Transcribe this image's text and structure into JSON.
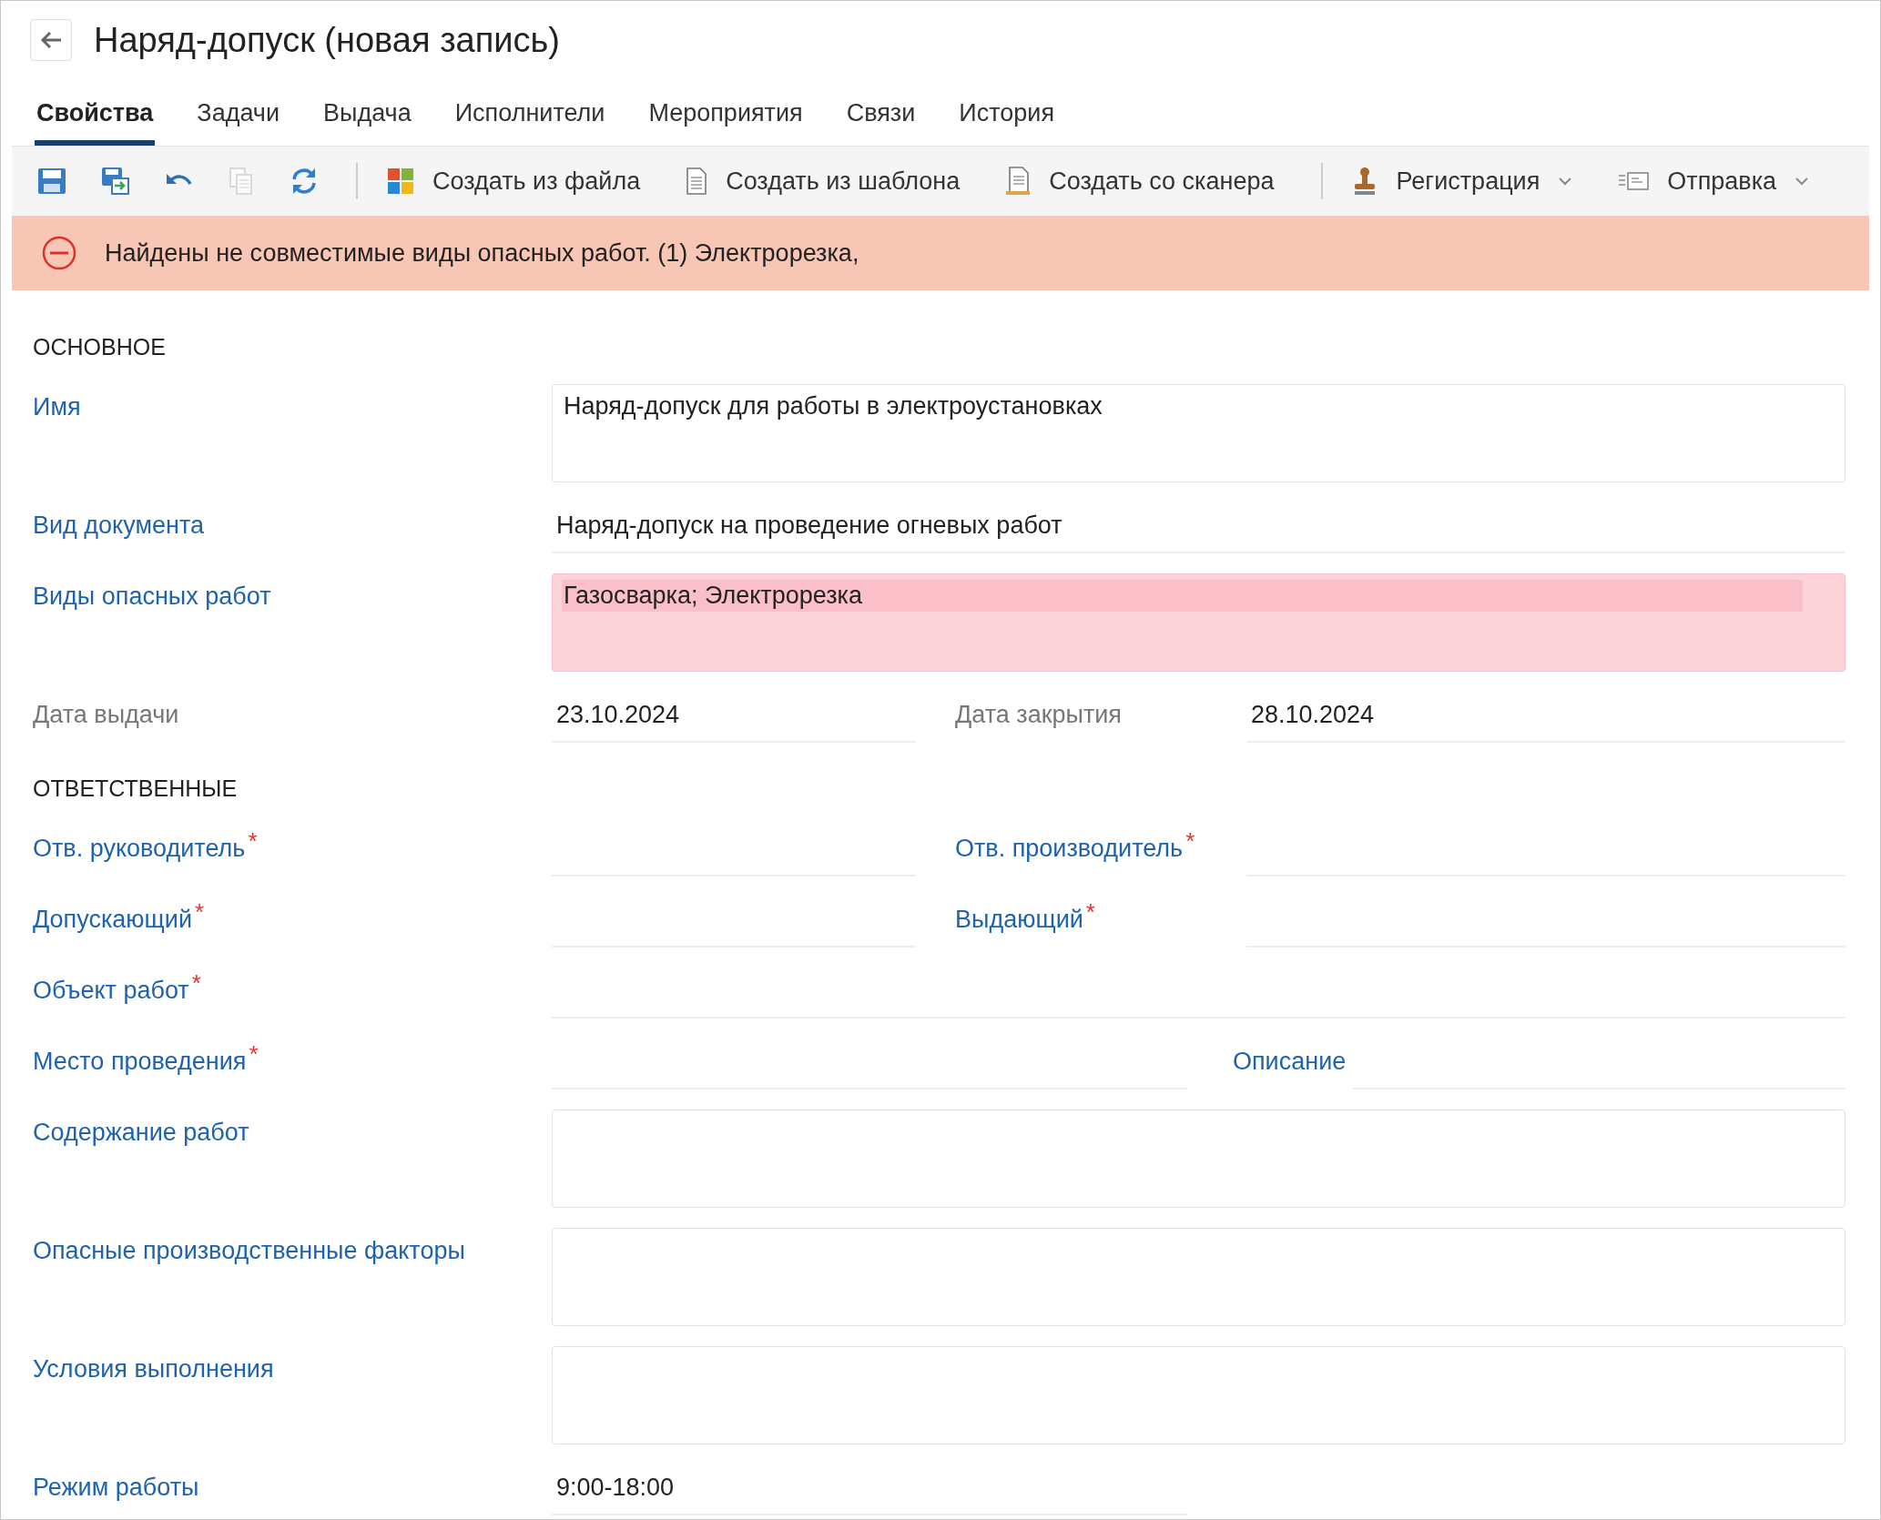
{
  "window": {
    "title": "Наряд-допуск (новая запись)"
  },
  "tabs": [
    {
      "label": "Свойства",
      "selected": true
    },
    {
      "label": "Задачи",
      "selected": false
    },
    {
      "label": "Выдача",
      "selected": false
    },
    {
      "label": "Исполнители",
      "selected": false
    },
    {
      "label": "Мероприятия",
      "selected": false
    },
    {
      "label": "Связи",
      "selected": false
    },
    {
      "label": "История",
      "selected": false
    }
  ],
  "toolbar": [
    {
      "kind": "icon",
      "disabled": false
    },
    {
      "kind": "icon",
      "disabled": false
    },
    {
      "kind": "icon",
      "disabled": false
    },
    {
      "kind": "icon",
      "disabled": true
    },
    {
      "kind": "icon",
      "disabled": false
    },
    {
      "kind": "separator"
    },
    {
      "kind": "text",
      "label": "Создать из файла",
      "dropdown": false
    },
    {
      "kind": "text",
      "label": "Создать из шаблона",
      "dropdown": false
    },
    {
      "kind": "text",
      "label": "Создать со сканера",
      "dropdown": false
    },
    {
      "kind": "separator"
    },
    {
      "kind": "text",
      "label": "Регистрация",
      "dropdown": true
    },
    {
      "kind": "text",
      "label": "Отправка",
      "dropdown": true
    }
  ],
  "error_banner": {
    "message": "Найдены не совместимые виды опасных работ. (1) Электрорезка,"
  },
  "sections": [
    {
      "title": "ОСНОВНОЕ",
      "rows": [
        {
          "kind": "area",
          "label": "Имя",
          "value": "Наряд-допуск для работы в электроустановках",
          "invalid": false
        },
        {
          "kind": "line",
          "label": "Вид документа",
          "value": "Наряд-допуск на проведение огневых работ"
        },
        {
          "kind": "area",
          "label": "Виды опасных работ",
          "value": "Газосварка; Электрорезка",
          "invalid": true
        },
        {
          "kind": "pair",
          "left": {
            "label": "Дата выдачи",
            "value": "23.10.2024",
            "readonly": true
          },
          "right": {
            "label": "Дата закрытия",
            "value": "28.10.2024",
            "readonly": true
          }
        }
      ]
    },
    {
      "title": "ОТВЕТСТВЕННЫЕ",
      "rows": [
        {
          "kind": "pair",
          "left": {
            "label": "Отв. руководитель",
            "mark": "*",
            "readonly": false
          },
          "right": {
            "label": "Отв. производитель",
            "mark": "*",
            "readonly": false
          }
        },
        {
          "kind": "pair",
          "left": {
            "label": "Допускающий",
            "mark": "*",
            "readonly": false
          },
          "right": {
            "label": "Выдающий",
            "mark": "*",
            "readonly": false
          }
        },
        {
          "kind": "line",
          "label": "Объект работ",
          "mark": "*"
        },
        {
          "kind": "pair_wide",
          "left": {
            "label": "Место проведения",
            "mark": "*",
            "readonly": false
          },
          "right": {
            "label": "Описание",
            "readonly": false
          }
        },
        {
          "kind": "area",
          "label": "Содержание работ",
          "invalid": false
        },
        {
          "kind": "area",
          "label": "Опасные производственные факторы",
          "invalid": false
        },
        {
          "kind": "area",
          "label": "Условия выполнения",
          "invalid": false
        },
        {
          "kind": "short",
          "label": "Режим работы",
          "value": "9:00-18:00"
        }
      ]
    }
  ]
}
